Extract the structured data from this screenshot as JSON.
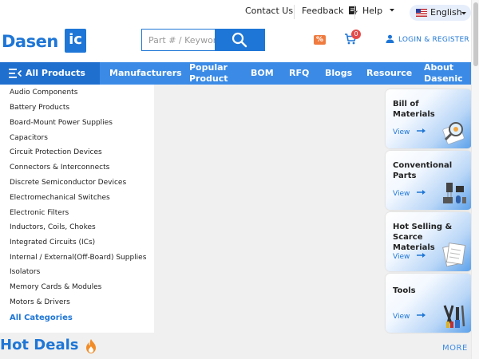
{
  "topbar": {
    "contact": "Contact Us",
    "feedback": "Feedback",
    "help": "Help",
    "language": "English"
  },
  "header": {
    "logo_text": "Dasen",
    "logo_chip": "ic",
    "search_placeholder": "Part # / Keywor",
    "login": "LOGIN & REGISTER",
    "cart_count": "0",
    "coupon_glyph": "%"
  },
  "nav": {
    "all_products": "All Products",
    "items": [
      {
        "label": "Manufacturers"
      },
      {
        "label": "Popular Product"
      },
      {
        "label": "BOM"
      },
      {
        "label": "RFQ"
      },
      {
        "label": "Blogs"
      },
      {
        "label": "Resource"
      },
      {
        "label": "About Dasenic"
      }
    ]
  },
  "categories": [
    "Audio Components",
    "Battery Products",
    "Board-Mount Power Supplies",
    "Capacitors",
    "Circuit Protection Devices",
    "Connectors & Interconnects",
    "Discrete Semiconductor Devices",
    "Electromechanical Switches",
    "Electronic Filters",
    "Inductors, Coils, Chokes",
    "Integrated Circuits (ICs)",
    "Internal / External(Off-Board) Supplies",
    "Isolators",
    "Memory Cards & Modules",
    "Motors & Drivers"
  ],
  "all_categories": "All Categories",
  "cards": [
    {
      "title": "Bill of Materials",
      "view": "View",
      "icon": "magnifier-document-icon"
    },
    {
      "title": "Conventional Parts",
      "view": "View",
      "icon": "components-icon"
    },
    {
      "title": "Hot Selling & Scarce Materials",
      "view": "View",
      "icon": "documents-icon"
    },
    {
      "title": "Tools",
      "view": "View",
      "icon": "tools-icon"
    }
  ],
  "hot_deals": "Hot Deals",
  "more": "MORE +",
  "colors": {
    "brand": "#1e76d6",
    "nav": "#3b8be6",
    "nav_active": "#1f6fcf",
    "badge": "#e54b4b",
    "coupon": "#f07b3f",
    "flame": "#f28c28"
  }
}
